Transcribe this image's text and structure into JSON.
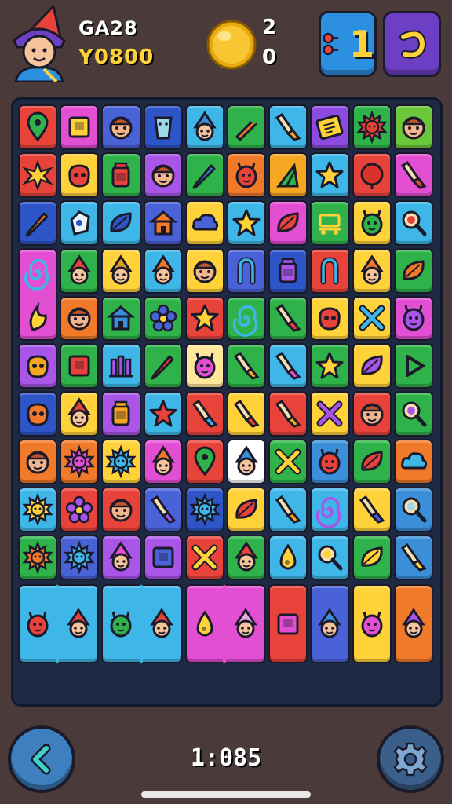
{
  "player": {
    "name": "GA28",
    "score": "Y0800",
    "avatar_icon": "wizard-avatar-icon"
  },
  "coins": {
    "top": "2",
    "bottom": "0",
    "icon": "gold-coin-icon"
  },
  "buttons": {
    "hint": {
      "label": "1",
      "icon": "hint-icon",
      "color": "#2c8fe0"
    },
    "undo": {
      "icon": "undo-icon",
      "color": "#6c3fc4"
    },
    "back": {
      "icon": "chevron-left-icon"
    },
    "settings": {
      "icon": "gear-icon"
    }
  },
  "timer": "1:085",
  "board": {
    "columns": 10,
    "rows": 12,
    "tiles": [
      {
        "r": 0,
        "c": 0,
        "bg": "#e8433a",
        "icon": "map-pin",
        "fg": "#2fb24a"
      },
      {
        "r": 0,
        "c": 1,
        "bg": "#e34fd2",
        "icon": "box",
        "fg": "#ffd23a"
      },
      {
        "r": 0,
        "c": 2,
        "bg": "#4a62d8",
        "icon": "face",
        "fg": "#f2b58c"
      },
      {
        "r": 0,
        "c": 3,
        "bg": "#2e55c8",
        "icon": "cup",
        "fg": "#9fd8e8"
      },
      {
        "r": 0,
        "c": 4,
        "bg": "#3fb6e8",
        "icon": "gnome",
        "fg": "#3a8fd8"
      },
      {
        "r": 0,
        "c": 5,
        "bg": "#2fb24a",
        "icon": "carrot",
        "fg": "#f07a2a"
      },
      {
        "r": 0,
        "c": 6,
        "bg": "#3fb6e8",
        "icon": "brush",
        "fg": "#f5a623"
      },
      {
        "r": 0,
        "c": 7,
        "bg": "#8d4ae0",
        "icon": "ticket",
        "fg": "#ffd23a"
      },
      {
        "r": 0,
        "c": 8,
        "bg": "#2fb24a",
        "icon": "sun",
        "fg": "#e8433a"
      },
      {
        "r": 0,
        "c": 9,
        "bg": "#6cc63a",
        "icon": "face",
        "fg": "#f2b58c"
      },
      {
        "r": 1,
        "c": 0,
        "bg": "#e8433a",
        "icon": "star-burst",
        "fg": "#ffd23a"
      },
      {
        "r": 1,
        "c": 1,
        "bg": "#ffd23a",
        "icon": "blob",
        "fg": "#e8433a"
      },
      {
        "r": 1,
        "c": 2,
        "bg": "#2fb24a",
        "icon": "jar",
        "fg": "#e8433a"
      },
      {
        "r": 1,
        "c": 3,
        "bg": "#a855e8",
        "icon": "face",
        "fg": "#f2b58c"
      },
      {
        "r": 1,
        "c": 4,
        "bg": "#2fb24a",
        "icon": "pencil",
        "fg": "#3a8fd8"
      },
      {
        "r": 1,
        "c": 5,
        "bg": "#f07a2a",
        "icon": "critter",
        "fg": "#e8433a"
      },
      {
        "r": 1,
        "c": 6,
        "bg": "#f5a623",
        "icon": "flag",
        "fg": "#2fb24a"
      },
      {
        "r": 1,
        "c": 7,
        "bg": "#3fb6e8",
        "icon": "star",
        "fg": "#ffd23a"
      },
      {
        "r": 1,
        "c": 8,
        "bg": "#e8433a",
        "icon": "round",
        "fg": "#d8322a"
      },
      {
        "r": 1,
        "c": 9,
        "bg": "#e34fd2",
        "icon": "brush",
        "fg": "#e8433a"
      },
      {
        "r": 2,
        "c": 0,
        "bg": "#2e55c8",
        "icon": "pencil",
        "fg": "#f07a2a"
      },
      {
        "r": 2,
        "c": 1,
        "bg": "#3fb6e8",
        "icon": "gem",
        "fg": "#2e55c8"
      },
      {
        "r": 2,
        "c": 2,
        "bg": "#3fb6e8",
        "icon": "leaf",
        "fg": "#2e55c8"
      },
      {
        "r": 2,
        "c": 3,
        "bg": "#4a62d8",
        "icon": "house",
        "fg": "#f07a2a"
      },
      {
        "r": 2,
        "c": 4,
        "bg": "#ffd23a",
        "icon": "cloud",
        "fg": "#4a62d8"
      },
      {
        "r": 2,
        "c": 5,
        "bg": "#3fb6e8",
        "icon": "star",
        "fg": "#ffd23a"
      },
      {
        "r": 2,
        "c": 6,
        "bg": "#e34fd2",
        "icon": "leaf",
        "fg": "#e8433a"
      },
      {
        "r": 2,
        "c": 7,
        "bg": "#2fb24a",
        "icon": "cart",
        "fg": "#ffd23a"
      },
      {
        "r": 2,
        "c": 8,
        "bg": "#ffd23a",
        "icon": "critter",
        "fg": "#2fb24a"
      },
      {
        "r": 2,
        "c": 9,
        "bg": "#3fb6e8",
        "icon": "magnifier",
        "fg": "#e8433a"
      },
      {
        "r": 3,
        "c": 0,
        "bg": "#e34fd2",
        "icon": "swirl",
        "fg": "#3fb6e8",
        "span": 2
      },
      {
        "r": 3,
        "c": 1,
        "bg": "#2fb24a",
        "icon": "gnome",
        "fg": "#e8433a"
      },
      {
        "r": 3,
        "c": 2,
        "bg": "#ffd23a",
        "icon": "gnome",
        "fg": "#d8a020"
      },
      {
        "r": 3,
        "c": 3,
        "bg": "#3fb6e8",
        "icon": "gnome",
        "fg": "#f07a2a"
      },
      {
        "r": 3,
        "c": 4,
        "bg": "#ffd23a",
        "icon": "face",
        "fg": "#f2b58c"
      },
      {
        "r": 3,
        "c": 5,
        "bg": "#4a62d8",
        "icon": "tongs",
        "fg": "#3fb6e8"
      },
      {
        "r": 3,
        "c": 6,
        "bg": "#2e55c8",
        "icon": "jar",
        "fg": "#a855e8"
      },
      {
        "r": 3,
        "c": 7,
        "bg": "#e8433a",
        "icon": "tongs",
        "fg": "#3fb6e8"
      },
      {
        "r": 3,
        "c": 8,
        "bg": "#ffd23a",
        "icon": "gnome",
        "fg": "#f07a2a"
      },
      {
        "r": 3,
        "c": 9,
        "bg": "#2fb24a",
        "icon": "leaf",
        "fg": "#f07a2a"
      },
      {
        "r": 4,
        "c": 1,
        "bg": "#f07a2a",
        "icon": "face",
        "fg": "#f2b58c"
      },
      {
        "r": 4,
        "c": 2,
        "bg": "#2fb24a",
        "icon": "house",
        "fg": "#3a8fd8"
      },
      {
        "r": 4,
        "c": 3,
        "bg": "#2fb24a",
        "icon": "flower",
        "fg": "#4a62d8"
      },
      {
        "r": 4,
        "c": 4,
        "bg": "#e8433a",
        "icon": "star",
        "fg": "#ffd23a"
      },
      {
        "r": 4,
        "c": 5,
        "bg": "#2fb24a",
        "icon": "swirl",
        "fg": "#3fb6e8"
      },
      {
        "r": 4,
        "c": 6,
        "bg": "#2fb24a",
        "icon": "brush",
        "fg": "#e8433a"
      },
      {
        "r": 4,
        "c": 7,
        "bg": "#ffd23a",
        "icon": "blob",
        "fg": "#e8433a"
      },
      {
        "r": 4,
        "c": 8,
        "bg": "#ffd23a",
        "icon": "cross",
        "fg": "#3fb6e8"
      },
      {
        "r": 4,
        "c": 9,
        "bg": "#e34fd2",
        "icon": "critter",
        "fg": "#a855e8"
      },
      {
        "r": 5,
        "c": 0,
        "bg": "#a855e8",
        "icon": "blob",
        "fg": "#f5a623"
      },
      {
        "r": 5,
        "c": 1,
        "bg": "#2fb24a",
        "icon": "box",
        "fg": "#e8433a"
      },
      {
        "r": 5,
        "c": 2,
        "bg": "#3fb6e8",
        "icon": "bars",
        "fg": "#a855e8"
      },
      {
        "r": 5,
        "c": 3,
        "bg": "#2fb24a",
        "icon": "pencil",
        "fg": "#e8433a"
      },
      {
        "r": 5,
        "c": 4,
        "bg": "#ffe89a",
        "icon": "critter",
        "fg": "#e34fd2"
      },
      {
        "r": 5,
        "c": 5,
        "bg": "#2fb24a",
        "icon": "brush",
        "fg": "#f5a623"
      },
      {
        "r": 5,
        "c": 6,
        "bg": "#3fb6e8",
        "icon": "brush",
        "fg": "#e34fd2"
      },
      {
        "r": 5,
        "c": 7,
        "bg": "#2fb24a",
        "icon": "star",
        "fg": "#ffd23a"
      },
      {
        "r": 5,
        "c": 8,
        "bg": "#ffd23a",
        "icon": "leaf",
        "fg": "#a855e8"
      },
      {
        "r": 5,
        "c": 9,
        "bg": "#2fb24a",
        "icon": "play",
        "fg": "#2fb24a"
      },
      {
        "r": 6,
        "c": 0,
        "bg": "#2e55c8",
        "icon": "blob",
        "fg": "#f07a2a"
      },
      {
        "r": 6,
        "c": 1,
        "bg": "#ffd23a",
        "icon": "gnome",
        "fg": "#e8433a"
      },
      {
        "r": 6,
        "c": 2,
        "bg": "#a855e8",
        "icon": "jar",
        "fg": "#f5a623"
      },
      {
        "r": 6,
        "c": 3,
        "bg": "#3fb6e8",
        "icon": "star",
        "fg": "#e8433a"
      },
      {
        "r": 6,
        "c": 4,
        "bg": "#e8433a",
        "icon": "brush",
        "fg": "#3fb6e8"
      },
      {
        "r": 6,
        "c": 5,
        "bg": "#ffd23a",
        "icon": "brush",
        "fg": "#e8433a"
      },
      {
        "r": 6,
        "c": 6,
        "bg": "#e8433a",
        "icon": "brush",
        "fg": "#f5a623"
      },
      {
        "r": 6,
        "c": 7,
        "bg": "#ffd23a",
        "icon": "cross",
        "fg": "#a855e8"
      },
      {
        "r": 6,
        "c": 8,
        "bg": "#e8433a",
        "icon": "face",
        "fg": "#f2b58c"
      },
      {
        "r": 6,
        "c": 9,
        "bg": "#2fb24a",
        "icon": "magnifier",
        "fg": "#a855e8"
      },
      {
        "r": 7,
        "c": 0,
        "bg": "#f07a2a",
        "icon": "face",
        "fg": "#f2b58c"
      },
      {
        "r": 7,
        "c": 1,
        "bg": "#f07a2a",
        "icon": "sun",
        "fg": "#e34fd2"
      },
      {
        "r": 7,
        "c": 2,
        "bg": "#ffd23a",
        "icon": "sun",
        "fg": "#3fb6e8"
      },
      {
        "r": 7,
        "c": 3,
        "bg": "#e34fd2",
        "icon": "gnome",
        "fg": "#f07a2a"
      },
      {
        "r": 7,
        "c": 4,
        "bg": "#e8433a",
        "icon": "map-pin",
        "fg": "#2fb24a"
      },
      {
        "r": 7,
        "c": 5,
        "bg": "#ffffff",
        "icon": "gnome",
        "fg": "#3a8fd8"
      },
      {
        "r": 7,
        "c": 6,
        "bg": "#2fb24a",
        "icon": "cross",
        "fg": "#ffd23a"
      },
      {
        "r": 7,
        "c": 7,
        "bg": "#3a8fd8",
        "icon": "critter",
        "fg": "#e8433a"
      },
      {
        "r": 7,
        "c": 8,
        "bg": "#2fb24a",
        "icon": "leaf",
        "fg": "#e8433a"
      },
      {
        "r": 7,
        "c": 9,
        "bg": "#f07a2a",
        "icon": "cloud",
        "fg": "#3fb6e8"
      },
      {
        "r": 8,
        "c": 0,
        "bg": "#3fb6e8",
        "icon": "sun",
        "fg": "#ffd23a"
      },
      {
        "r": 8,
        "c": 1,
        "bg": "#e8433a",
        "icon": "flower",
        "fg": "#a855e8"
      },
      {
        "r": 8,
        "c": 2,
        "bg": "#e8433a",
        "icon": "face",
        "fg": "#f2b58c"
      },
      {
        "r": 8,
        "c": 3,
        "bg": "#4a62d8",
        "icon": "brush",
        "fg": "#a855e8"
      },
      {
        "r": 8,
        "c": 4,
        "bg": "#2e55c8",
        "icon": "sun",
        "fg": "#3fb6e8"
      },
      {
        "r": 8,
        "c": 5,
        "bg": "#ffd23a",
        "icon": "leaf",
        "fg": "#e8433a"
      },
      {
        "r": 8,
        "c": 6,
        "bg": "#3fb6e8",
        "icon": "brush",
        "fg": "#f5a623"
      },
      {
        "r": 8,
        "c": 7,
        "bg": "#3fb6e8",
        "icon": "swirl",
        "fg": "#a855e8"
      },
      {
        "r": 8,
        "c": 8,
        "bg": "#ffd23a",
        "icon": "brush",
        "fg": "#4a62d8"
      },
      {
        "r": 8,
        "c": 9,
        "bg": "#3a8fd8",
        "icon": "magnifier",
        "fg": "#9fd8e8"
      },
      {
        "r": 9,
        "c": 0,
        "bg": "#2fb24a",
        "icon": "sun",
        "fg": "#f07a2a"
      },
      {
        "r": 9,
        "c": 1,
        "bg": "#4a62d8",
        "icon": "sun",
        "fg": "#3fb6e8"
      },
      {
        "r": 9,
        "c": 2,
        "bg": "#a855e8",
        "icon": "gnome",
        "fg": "#e34fd2"
      },
      {
        "r": 9,
        "c": 3,
        "bg": "#a855e8",
        "icon": "box",
        "fg": "#4a62d8"
      },
      {
        "r": 9,
        "c": 4,
        "bg": "#e8433a",
        "icon": "cross",
        "fg": "#ffd23a"
      },
      {
        "r": 9,
        "c": 5,
        "bg": "#2fb24a",
        "icon": "gnome",
        "fg": "#e8433a"
      },
      {
        "r": 9,
        "c": 6,
        "bg": "#3fb6e8",
        "icon": "drop",
        "fg": "#ffd23a"
      },
      {
        "r": 9,
        "c": 7,
        "bg": "#3fb6e8",
        "icon": "magnifier",
        "fg": "#ffd23a"
      },
      {
        "r": 9,
        "c": 8,
        "bg": "#2fb24a",
        "icon": "leaf",
        "fg": "#ffd23a"
      },
      {
        "r": 9,
        "c": 9,
        "bg": "#3a8fd8",
        "icon": "brush",
        "fg": "#ffd23a"
      },
      {
        "r": 10,
        "c": 0,
        "bg": "#3fb6e8",
        "icon": "critter",
        "fg": "#e8433a",
        "wide": true
      },
      {
        "r": 10,
        "c": 1,
        "bg": "#3fb6e8",
        "icon": "gnome",
        "fg": "#e8433a",
        "wideSecond": true
      },
      {
        "r": 10,
        "c": 2,
        "bg": "#3fb6e8",
        "icon": "critter",
        "fg": "#2fb24a",
        "wide": true
      },
      {
        "r": 10,
        "c": 3,
        "bg": "#3fb6e8",
        "icon": "gnome",
        "fg": "#e8433a",
        "wideSecond": true
      },
      {
        "r": 10,
        "c": 4,
        "bg": "#e34fd2",
        "icon": "drop",
        "fg": "#ffd23a",
        "wide": true
      },
      {
        "r": 10,
        "c": 5,
        "bg": "#e34fd2",
        "icon": "gnome",
        "fg": "#e8a8e8",
        "wideSecond": true
      },
      {
        "r": 10,
        "c": 6,
        "bg": "#e8433a",
        "icon": "box",
        "fg": "#e34fd2"
      },
      {
        "r": 10,
        "c": 7,
        "bg": "#4a62d8",
        "icon": "gnome",
        "fg": "#3a8fd8"
      },
      {
        "r": 10,
        "c": 8,
        "bg": "#ffd23a",
        "icon": "critter",
        "fg": "#e34fd2"
      },
      {
        "r": 10,
        "c": 9,
        "bg": "#f07a2a",
        "icon": "gnome",
        "fg": "#a855e8"
      }
    ]
  }
}
